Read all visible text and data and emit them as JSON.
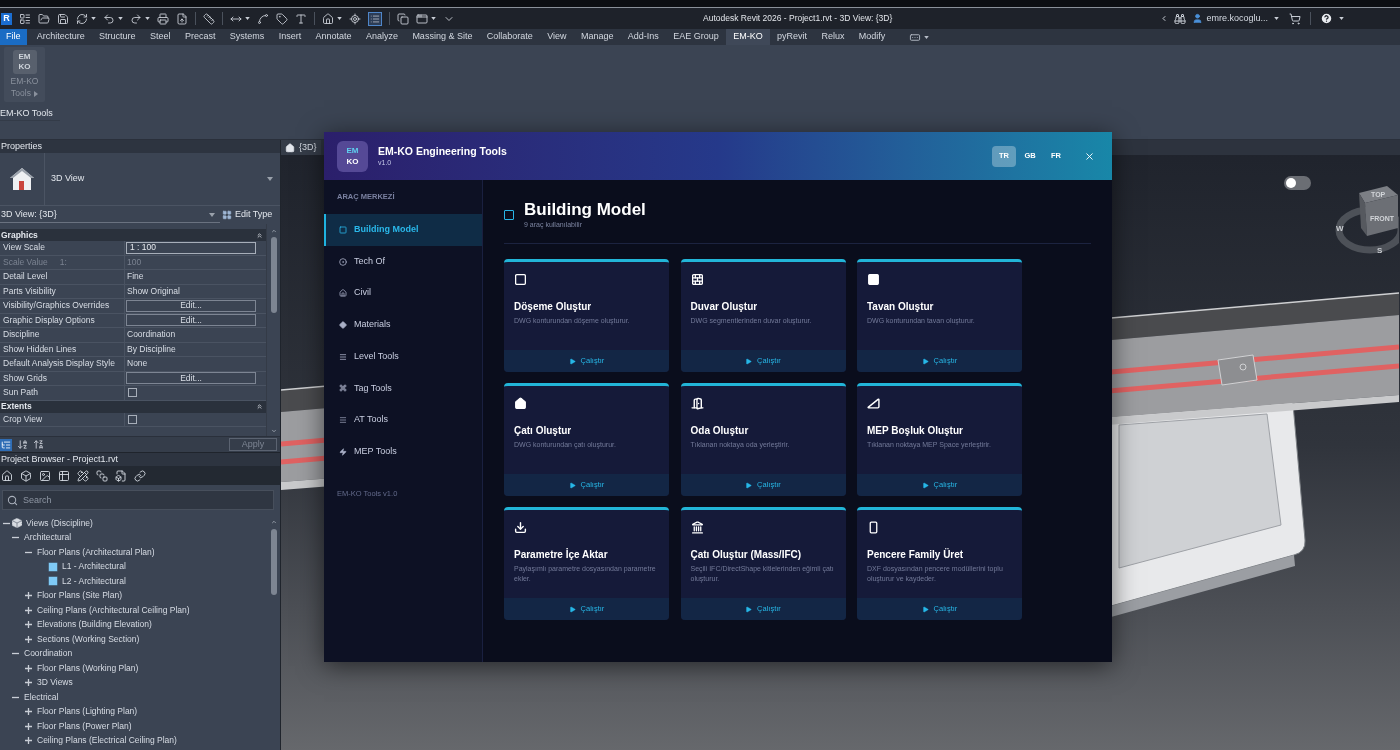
{
  "title_bar": {
    "app_logo": "R",
    "title": "Autodesk Revit 2026 - Project1.rvt - 3D View: {3D}",
    "user": "emre.kocoglu..."
  },
  "ribbon": {
    "tabs": [
      {
        "label": "File",
        "kind": "file",
        "selected": false
      },
      {
        "label": "Architecture",
        "kind": "tab",
        "selected": false
      },
      {
        "label": "Structure",
        "kind": "tab",
        "selected": false
      },
      {
        "label": "Steel",
        "kind": "tab",
        "selected": false
      },
      {
        "label": "Precast",
        "kind": "tab",
        "selected": false
      },
      {
        "label": "Systems",
        "kind": "tab",
        "selected": false
      },
      {
        "label": "Insert",
        "kind": "tab",
        "selected": false
      },
      {
        "label": "Annotate",
        "kind": "tab",
        "selected": false
      },
      {
        "label": "Analyze",
        "kind": "tab",
        "selected": false
      },
      {
        "label": "Massing & Site",
        "kind": "tab",
        "selected": false
      },
      {
        "label": "Collaborate",
        "kind": "tab",
        "selected": false
      },
      {
        "label": "View",
        "kind": "tab",
        "selected": false
      },
      {
        "label": "Manage",
        "kind": "tab",
        "selected": false
      },
      {
        "label": "Add-Ins",
        "kind": "tab",
        "selected": false
      },
      {
        "label": "EAE Group",
        "kind": "tab",
        "selected": false
      },
      {
        "label": "EM-KO",
        "kind": "tab",
        "selected": true
      },
      {
        "label": "pyRevit",
        "kind": "tab",
        "selected": false
      },
      {
        "label": "Relux",
        "kind": "tab",
        "selected": false
      },
      {
        "label": "Modify",
        "kind": "tab",
        "selected": false
      }
    ],
    "panel": {
      "button": {
        "logo": [
          "EM",
          "KO"
        ],
        "label": "EM-KO Tools",
        "disabled": true
      },
      "title": "EM-KO Tools"
    }
  },
  "properties": {
    "title": "Properties",
    "type": "3D View",
    "instance": "3D View: {3D}",
    "edit_type": "Edit Type",
    "groups": [
      {
        "name": "Graphics",
        "expanded": true,
        "rows": [
          {
            "kind": "input",
            "label": "View Scale",
            "value": "1 : 100"
          },
          {
            "kind": "text",
            "label": "Scale Value",
            "suffix": "1:",
            "value": "100",
            "disabled": true
          },
          {
            "kind": "text",
            "label": "Detail Level",
            "value": "Fine",
            "disabled": false
          },
          {
            "kind": "text",
            "label": "Parts Visibility",
            "value": "Show Original",
            "disabled": false
          },
          {
            "kind": "button",
            "label": "Visibility/Graphics Overrides",
            "value": "Edit..."
          },
          {
            "kind": "button",
            "label": "Graphic Display Options",
            "value": "Edit..."
          },
          {
            "kind": "text",
            "label": "Discipline",
            "value": "Coordination",
            "disabled": false
          },
          {
            "kind": "text",
            "label": "Show Hidden Lines",
            "value": "By Discipline",
            "disabled": false
          },
          {
            "kind": "text",
            "label": "Default Analysis Display Style",
            "value": "None",
            "disabled": false
          },
          {
            "kind": "button",
            "label": "Show Grids",
            "value": "Edit..."
          },
          {
            "kind": "checkbox",
            "label": "Sun Path",
            "checked": false
          }
        ]
      },
      {
        "name": "Extents",
        "expanded": true,
        "rows": [
          {
            "kind": "checkbox",
            "label": "Crop View",
            "checked": false
          }
        ]
      }
    ],
    "apply": {
      "label": "Apply",
      "disabled": true
    }
  },
  "project_browser": {
    "title": "Project Browser - Project1.rvt",
    "search": {
      "placeholder": "Search"
    },
    "tree": [
      {
        "label": "Views (Discipline)",
        "kind": "views",
        "expanded": true,
        "children": [
          {
            "label": "Architectural",
            "kind": "group",
            "expanded": true,
            "children": [
              {
                "label": "Floor Plans (Architectural Plan)",
                "kind": "group",
                "expanded": true,
                "children": [
                  {
                    "label": "L1 - Architectural",
                    "kind": "view"
                  },
                  {
                    "label": "L2 - Architectural",
                    "kind": "view"
                  }
                ]
              },
              {
                "label": "Floor Plans (Site Plan)",
                "kind": "group",
                "expanded": false
              },
              {
                "label": "Ceiling Plans (Architectural Ceiling Plan)",
                "kind": "group",
                "expanded": false
              },
              {
                "label": "Elevations (Building Elevation)",
                "kind": "group",
                "expanded": false
              },
              {
                "label": "Sections (Working Section)",
                "kind": "group",
                "expanded": false
              }
            ]
          },
          {
            "label": "Coordination",
            "kind": "group",
            "expanded": true,
            "children": [
              {
                "label": "Floor Plans (Working Plan)",
                "kind": "group",
                "expanded": false
              },
              {
                "label": "3D Views",
                "kind": "group",
                "expanded": false
              }
            ]
          },
          {
            "label": "Electrical",
            "kind": "group",
            "expanded": true,
            "children": [
              {
                "label": "Floor Plans (Lighting Plan)",
                "kind": "group",
                "expanded": false
              },
              {
                "label": "Floor Plans (Power Plan)",
                "kind": "group",
                "expanded": false
              },
              {
                "label": "Ceiling Plans (Electrical Ceiling Plan)",
                "kind": "group",
                "expanded": false
              }
            ]
          }
        ]
      }
    ]
  },
  "viewport": {
    "tab": "{3D}",
    "switch": {
      "on": false
    },
    "viewcube": {
      "top_face": "TOP",
      "front_face": "FRONT",
      "compass": [
        "W",
        "S"
      ]
    }
  },
  "dialog": {
    "logo": [
      "EM",
      "KO"
    ],
    "title": "EM-KO Engineering Tools",
    "version": "v1.0",
    "languages": [
      {
        "label": "TR",
        "selected": true
      },
      {
        "label": "GB",
        "selected": false
      },
      {
        "label": "FR",
        "selected": false
      }
    ],
    "sidebar": {
      "heading": "ARAÇ MERKEZİ",
      "items": [
        {
          "label": "Building Model",
          "selected": true
        },
        {
          "label": "Tech Of",
          "selected": false
        },
        {
          "label": "Civil",
          "selected": false
        },
        {
          "label": "Materials",
          "selected": false
        },
        {
          "label": "Level Tools",
          "selected": false
        },
        {
          "label": "Tag Tools",
          "selected": false
        },
        {
          "label": "AT Tools",
          "selected": false
        },
        {
          "label": "MEP Tools",
          "selected": false
        }
      ],
      "footer": "EM-KO Tools v1.0"
    },
    "content": {
      "title": "Building Model",
      "subtitle": "9 araç kullanılabilir",
      "tools": [
        {
          "title": "Döşeme Oluştur",
          "description": "DWG konturundan döşeme oluşturur.",
          "action": "Çalıştır"
        },
        {
          "title": "Duvar Oluştur",
          "description": "DWG segmentlerinden duvar oluşturur.",
          "action": "Çalıştır"
        },
        {
          "title": "Tavan Oluştur",
          "description": "DWG konturundan tavan oluşturur.",
          "action": "Çalıştır"
        },
        {
          "title": "Çatı Oluştur",
          "description": "DWG konturundan çatı oluşturur.",
          "action": "Çalıştır"
        },
        {
          "title": "Oda Oluştur",
          "description": "Tıklanan noktaya oda yerleştirir.",
          "action": "Çalıştır"
        },
        {
          "title": "MEP Boşluk Oluştur",
          "description": "Tıklanan noktaya MEP Space yerleştirir.",
          "action": "Çalıştır"
        },
        {
          "title": "Parametre İçe Aktar",
          "description": "Paylaşımlı parametre dosyasından parametre ekler.",
          "action": "Çalıştır"
        },
        {
          "title": "Çatı Oluştur (Mass/IFC)",
          "description": "Seçili IFC/DirectShape kitlelerinden eğimli çatı oluşturur.",
          "action": "Çalıştır"
        },
        {
          "title": "Pencere Family Üret",
          "description": "DXF dosyasından pencere modüllerini toplu oluşturur ve kaydeder.",
          "action": "Çalıştır"
        }
      ]
    }
  }
}
